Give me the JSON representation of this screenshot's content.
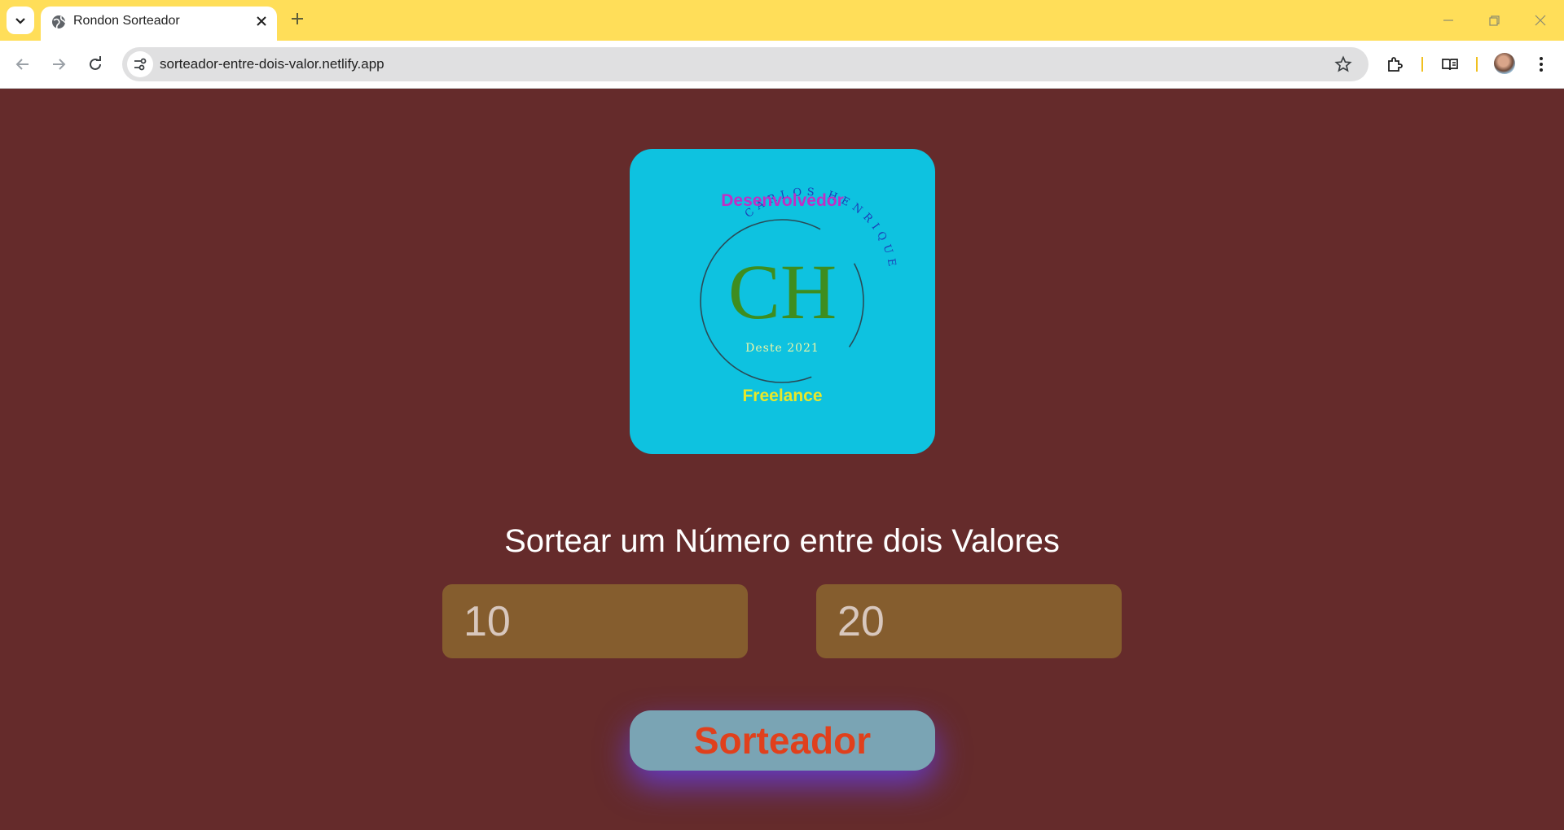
{
  "browser": {
    "tab_title": "Rondon Sorteador",
    "url": "sorteador-entre-dois-valor.netlify.app",
    "icons": [
      "tab-search-icon",
      "globe-icon",
      "close-icon",
      "plus-icon",
      "minimize-icon",
      "restore-icon",
      "window-close-icon",
      "back-arrow-icon",
      "forward-arrow-icon",
      "reload-icon",
      "site-info-icon",
      "star-icon",
      "extensions-icon",
      "reading-list-icon",
      "avatar",
      "more-vert-icon"
    ]
  },
  "logo": {
    "top_text": "Desenvolvedor",
    "arc_text": "CARLOS HENRIQUE",
    "monogram": "CH",
    "since_text": "Deste 2021",
    "bottom_text": "Freelance"
  },
  "main": {
    "heading": "Sortear um Número entre dois Valores",
    "input_min": {
      "placeholder": "10"
    },
    "input_max": {
      "placeholder": "20"
    },
    "draw_button_label": "Sorteador"
  },
  "colors": {
    "page_bg": "#652b2b",
    "tabbar_bg": "#ffde59",
    "logo_bg": "#0ec2e0",
    "input_bg": "#855d2e",
    "button_bg": "#7aa4b4",
    "button_text": "#e0401c",
    "button_glow": "#643cdc"
  }
}
